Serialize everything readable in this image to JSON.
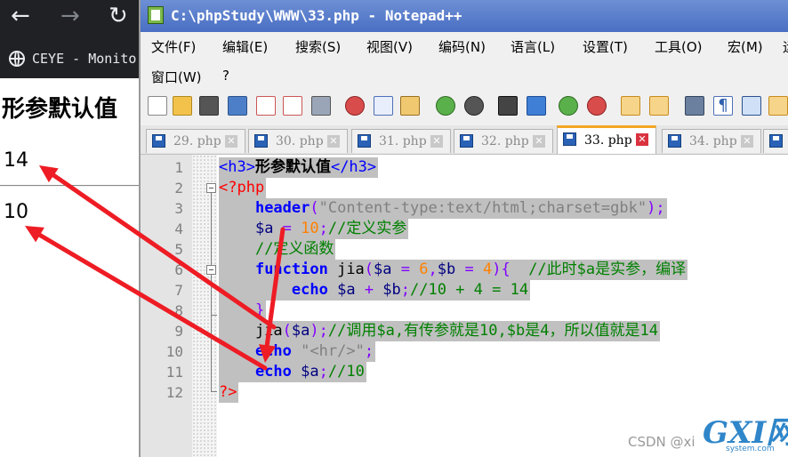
{
  "browser": {
    "nav": {
      "back_icon": "arrow-left-icon",
      "forward_icon": "arrow-right-icon",
      "reload_icon": "reload-icon"
    },
    "tab_title": "CEYE - Monito",
    "content": {
      "heading": "形参默认值",
      "output_lines": [
        "14",
        "10"
      ]
    }
  },
  "notepad": {
    "title": "C:\\phpStudy\\WWW\\33.php - Notepad++",
    "menu": [
      "文件(F)",
      "编辑(E)",
      "搜索(S)",
      "视图(V)",
      "编码(N)",
      "语言(L)",
      "设置(T)",
      "工具(O)",
      "宏(M)",
      "运",
      "窗口(W)",
      "?"
    ],
    "tabs": [
      {
        "label": "29. php",
        "active": false
      },
      {
        "label": "30. php",
        "active": false
      },
      {
        "label": "31. php",
        "active": false
      },
      {
        "label": "32. php",
        "active": false
      },
      {
        "label": "33. php",
        "active": true
      },
      {
        "label": "34. php",
        "active": false
      },
      {
        "label": "",
        "active": false
      }
    ],
    "code_lines": [
      {
        "n": "1",
        "tokens": [
          [
            "tag",
            "<h3>"
          ],
          [
            "bold",
            "形参默认值"
          ],
          [
            "tag",
            "</h3>"
          ]
        ]
      },
      {
        "n": "2",
        "tokens": [
          [
            "php",
            "<?php"
          ]
        ]
      },
      {
        "n": "3",
        "tokens": [
          [
            "txt",
            "    "
          ],
          [
            "kw",
            "header"
          ],
          [
            "op",
            "("
          ],
          [
            "str",
            "\"Content-type:text/html;charset=gbk\""
          ],
          [
            "op",
            ");"
          ]
        ]
      },
      {
        "n": "4",
        "tokens": [
          [
            "txt",
            "    "
          ],
          [
            "var",
            "$a"
          ],
          [
            "op",
            " = "
          ],
          [
            "num",
            "10"
          ],
          [
            "op",
            ";"
          ],
          [
            "cmt",
            "//定义实参"
          ]
        ]
      },
      {
        "n": "5",
        "tokens": [
          [
            "txt",
            "    "
          ],
          [
            "cmt",
            "//定义函数"
          ]
        ]
      },
      {
        "n": "6",
        "tokens": [
          [
            "txt",
            "    "
          ],
          [
            "kw",
            "function"
          ],
          [
            "txt",
            " jia"
          ],
          [
            "op",
            "("
          ],
          [
            "var",
            "$a"
          ],
          [
            "op",
            " = "
          ],
          [
            "num",
            "6"
          ],
          [
            "op",
            ","
          ],
          [
            "var",
            "$b"
          ],
          [
            "op",
            " = "
          ],
          [
            "num",
            "4"
          ],
          [
            "op",
            ")"
          ],
          [
            "op",
            "{"
          ],
          [
            "txt",
            "  "
          ],
          [
            "cmt",
            "//此时$a是实参，编译"
          ]
        ]
      },
      {
        "n": "7",
        "tokens": [
          [
            "txt",
            "        "
          ],
          [
            "kw",
            "echo"
          ],
          [
            "txt",
            " "
          ],
          [
            "var",
            "$a"
          ],
          [
            "op",
            " + "
          ],
          [
            "var",
            "$b"
          ],
          [
            "op",
            ";"
          ],
          [
            "cmt",
            "//10 + 4 = 14"
          ]
        ]
      },
      {
        "n": "8",
        "tokens": [
          [
            "txt",
            "    "
          ],
          [
            "op",
            "}"
          ]
        ]
      },
      {
        "n": "9",
        "tokens": [
          [
            "txt",
            "    jia"
          ],
          [
            "op",
            "("
          ],
          [
            "var",
            "$a"
          ],
          [
            "op",
            ");"
          ],
          [
            "cmt",
            "//调用$a,有传参就是10,$b是4，所以值就是14"
          ]
        ]
      },
      {
        "n": "10",
        "tokens": [
          [
            "txt",
            "    "
          ],
          [
            "kw",
            "echo"
          ],
          [
            "txt",
            " "
          ],
          [
            "str",
            "\"<hr/>\""
          ],
          [
            "op",
            ";"
          ]
        ]
      },
      {
        "n": "11",
        "tokens": [
          [
            "txt",
            "    "
          ],
          [
            "kw",
            "echo"
          ],
          [
            "txt",
            " "
          ],
          [
            "var",
            "$a"
          ],
          [
            "op",
            ";"
          ],
          [
            "cmt",
            "//10"
          ]
        ]
      },
      {
        "n": "12",
        "tokens": [
          [
            "php",
            "?>"
          ]
        ]
      }
    ]
  },
  "annotation_color": "#ee1c24",
  "watermark": {
    "csdn": "CSDN @xi",
    "logo": "GXI网",
    "site": "system.com"
  }
}
